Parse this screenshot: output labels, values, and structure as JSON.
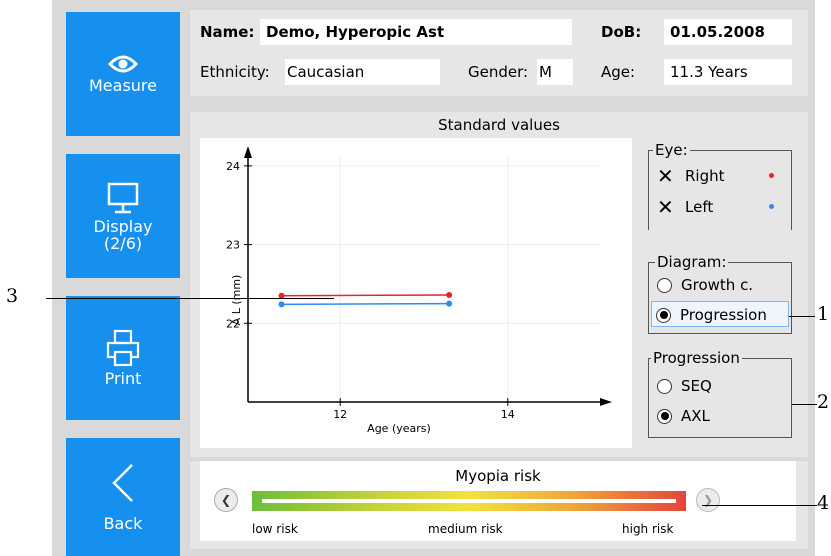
{
  "sidebar": {
    "buttons": [
      {
        "label": "Measure",
        "icon": "eye-icon"
      },
      {
        "label": "Display\n(2/6)",
        "icon": "monitor-icon"
      },
      {
        "label": "Print",
        "icon": "printer-icon"
      },
      {
        "label": "Back",
        "icon": "chevron-left-icon"
      }
    ]
  },
  "patient": {
    "name_label": "Name:",
    "name_value": "Demo, Hyperopic Ast",
    "dob_label": "DoB:",
    "dob_value": "01.05.2008",
    "ethnicity_label": "Ethnicity:",
    "ethnicity_value": "Caucasian",
    "gender_label": "Gender:",
    "gender_value": "M",
    "age_label": "Age:",
    "age_value": "11.3 Years"
  },
  "standard_values": {
    "title": "Standard values"
  },
  "chart_data": {
    "type": "line",
    "title": "",
    "xlabel": "Age (years)",
    "ylabel": "A L (mm)",
    "x_ticks": [
      12,
      14
    ],
    "y_ticks": [
      22,
      23,
      24
    ],
    "xlim": [
      10.9,
      15.1
    ],
    "ylim": [
      21.0,
      24.1
    ],
    "grid": true,
    "series": [
      {
        "name": "Right",
        "color": "#e8232b",
        "x": [
          11.3,
          13.3
        ],
        "y": [
          22.35,
          22.36
        ]
      },
      {
        "name": "Left",
        "color": "#2a8cf0",
        "x": [
          11.3,
          13.3
        ],
        "y": [
          22.24,
          22.25
        ]
      }
    ]
  },
  "eye_group": {
    "title": "Eye:",
    "options": [
      {
        "label": "Right",
        "checked": true,
        "color": "#e8232b"
      },
      {
        "label": "Left",
        "checked": true,
        "color": "#2a8cf0"
      }
    ]
  },
  "diagram_group": {
    "title": "Diagram:",
    "options": [
      {
        "label": "Growth c.",
        "selected": false
      },
      {
        "label": "Progression",
        "selected": true
      }
    ]
  },
  "progression_group": {
    "title": "Progression",
    "options": [
      {
        "label": "SEQ",
        "selected": false
      },
      {
        "label": "AXL",
        "selected": true
      }
    ]
  },
  "myopia": {
    "title": "Myopia risk",
    "low": "low risk",
    "medium": "medium risk",
    "high": "high risk"
  },
  "callouts": [
    "1",
    "2",
    "3",
    "4"
  ]
}
